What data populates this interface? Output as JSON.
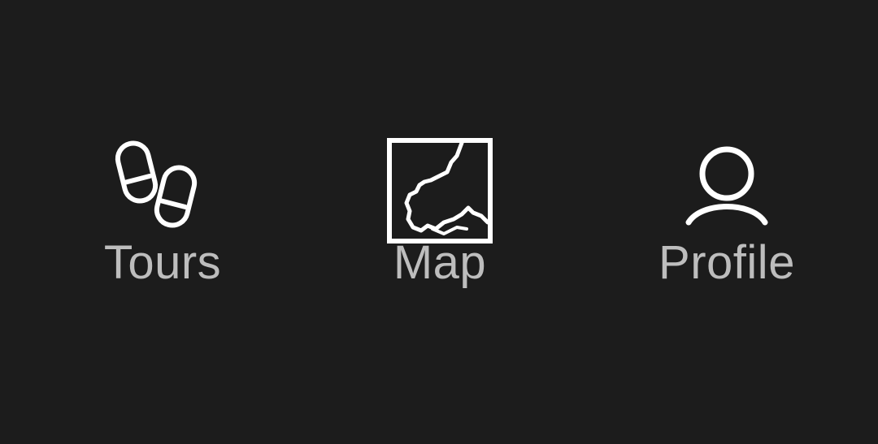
{
  "bottom_nav": {
    "tabs": [
      {
        "label": "Tours",
        "icon": "footprints-icon"
      },
      {
        "label": "Map",
        "icon": "map-icon"
      },
      {
        "label": "Profile",
        "icon": "user-icon"
      }
    ]
  },
  "colors": {
    "background": "#1c1c1c",
    "icon": "#ffffff",
    "label": "#bdbdbd"
  }
}
